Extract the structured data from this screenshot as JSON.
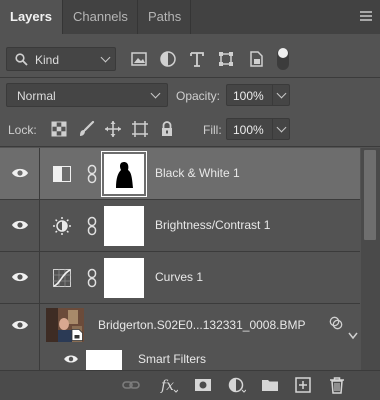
{
  "tabs": [
    "Layers",
    "Channels",
    "Paths"
  ],
  "filter": {
    "kind_label": "Kind"
  },
  "blend": {
    "mode": "Normal",
    "opacity_label": "Opacity:",
    "opacity_value": "100%",
    "lock_label": "Lock:",
    "fill_label": "Fill:",
    "fill_value": "100%"
  },
  "layers": [
    {
      "name": "Black & White 1",
      "type": "black-white",
      "selected": true
    },
    {
      "name": "Brightness/Contrast 1",
      "type": "brightness-contrast",
      "selected": false
    },
    {
      "name": "Curves 1",
      "type": "curves",
      "selected": false
    },
    {
      "name": "Bridgerton.S02E0...132331_0008.BMP",
      "type": "smart-object",
      "selected": false
    }
  ],
  "smart_filters_label": "Smart Filters",
  "footer_icons": [
    "link-layers-icon",
    "fx-icon",
    "add-mask-icon",
    "adjustment-icon",
    "new-group-icon",
    "new-layer-icon",
    "trash-icon"
  ]
}
